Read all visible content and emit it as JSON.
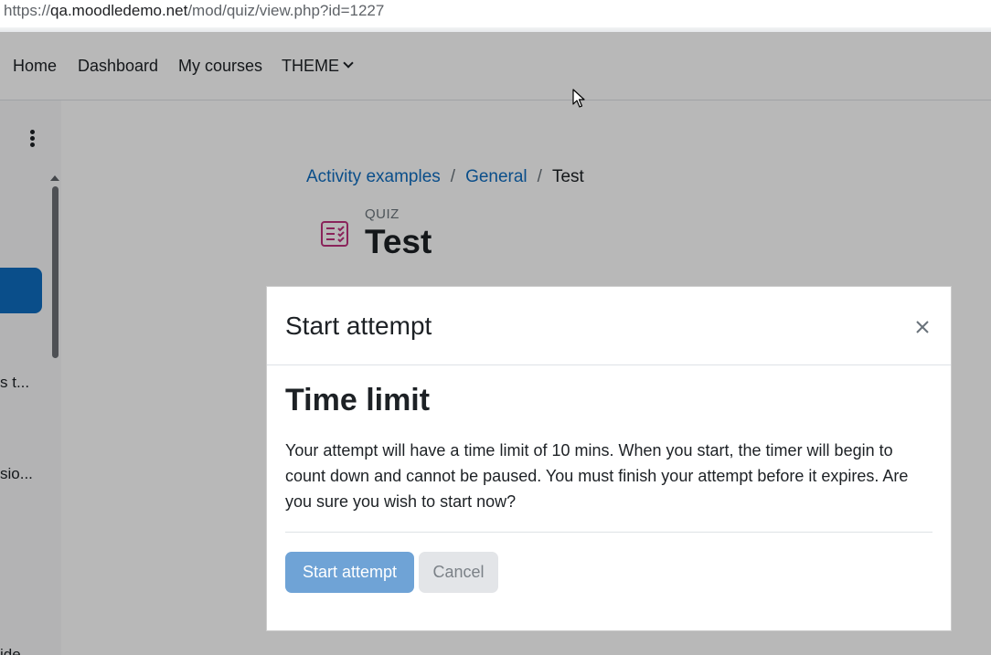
{
  "browser": {
    "url_prefix": "https://",
    "url_host": "qa.moodledemo.net",
    "url_path": "/mod/quiz/view.php?id=1227"
  },
  "navbar": {
    "items": [
      {
        "label": "Home"
      },
      {
        "label": "Dashboard"
      },
      {
        "label": "My courses"
      },
      {
        "label": "THEME",
        "icon": "chevron-down-icon"
      }
    ]
  },
  "drawer": {
    "menu_icon": "kebab-menu-icon",
    "snippets": [
      "s t...",
      "sio...",
      "ide"
    ]
  },
  "breadcrumb": {
    "items": [
      "Activity examples",
      "General",
      "Test"
    ],
    "separator": "/"
  },
  "activity": {
    "type_label": "QUIZ",
    "title": "Test",
    "icon": "quiz-icon",
    "icon_color": "#c0317d"
  },
  "modal": {
    "title": "Start attempt",
    "close_icon": "close-icon",
    "heading": "Time limit",
    "body": "Your attempt will have a time limit of 10 mins. When you start, the timer will begin to count down and cannot be paused. You must finish your attempt before it expires. Are you sure you wish to start now?",
    "primary_button": "Start attempt",
    "secondary_button": "Cancel"
  },
  "colors": {
    "brand": "#0f6cbf",
    "primary_button": "#6fa3d6",
    "text": "#1d2125"
  }
}
